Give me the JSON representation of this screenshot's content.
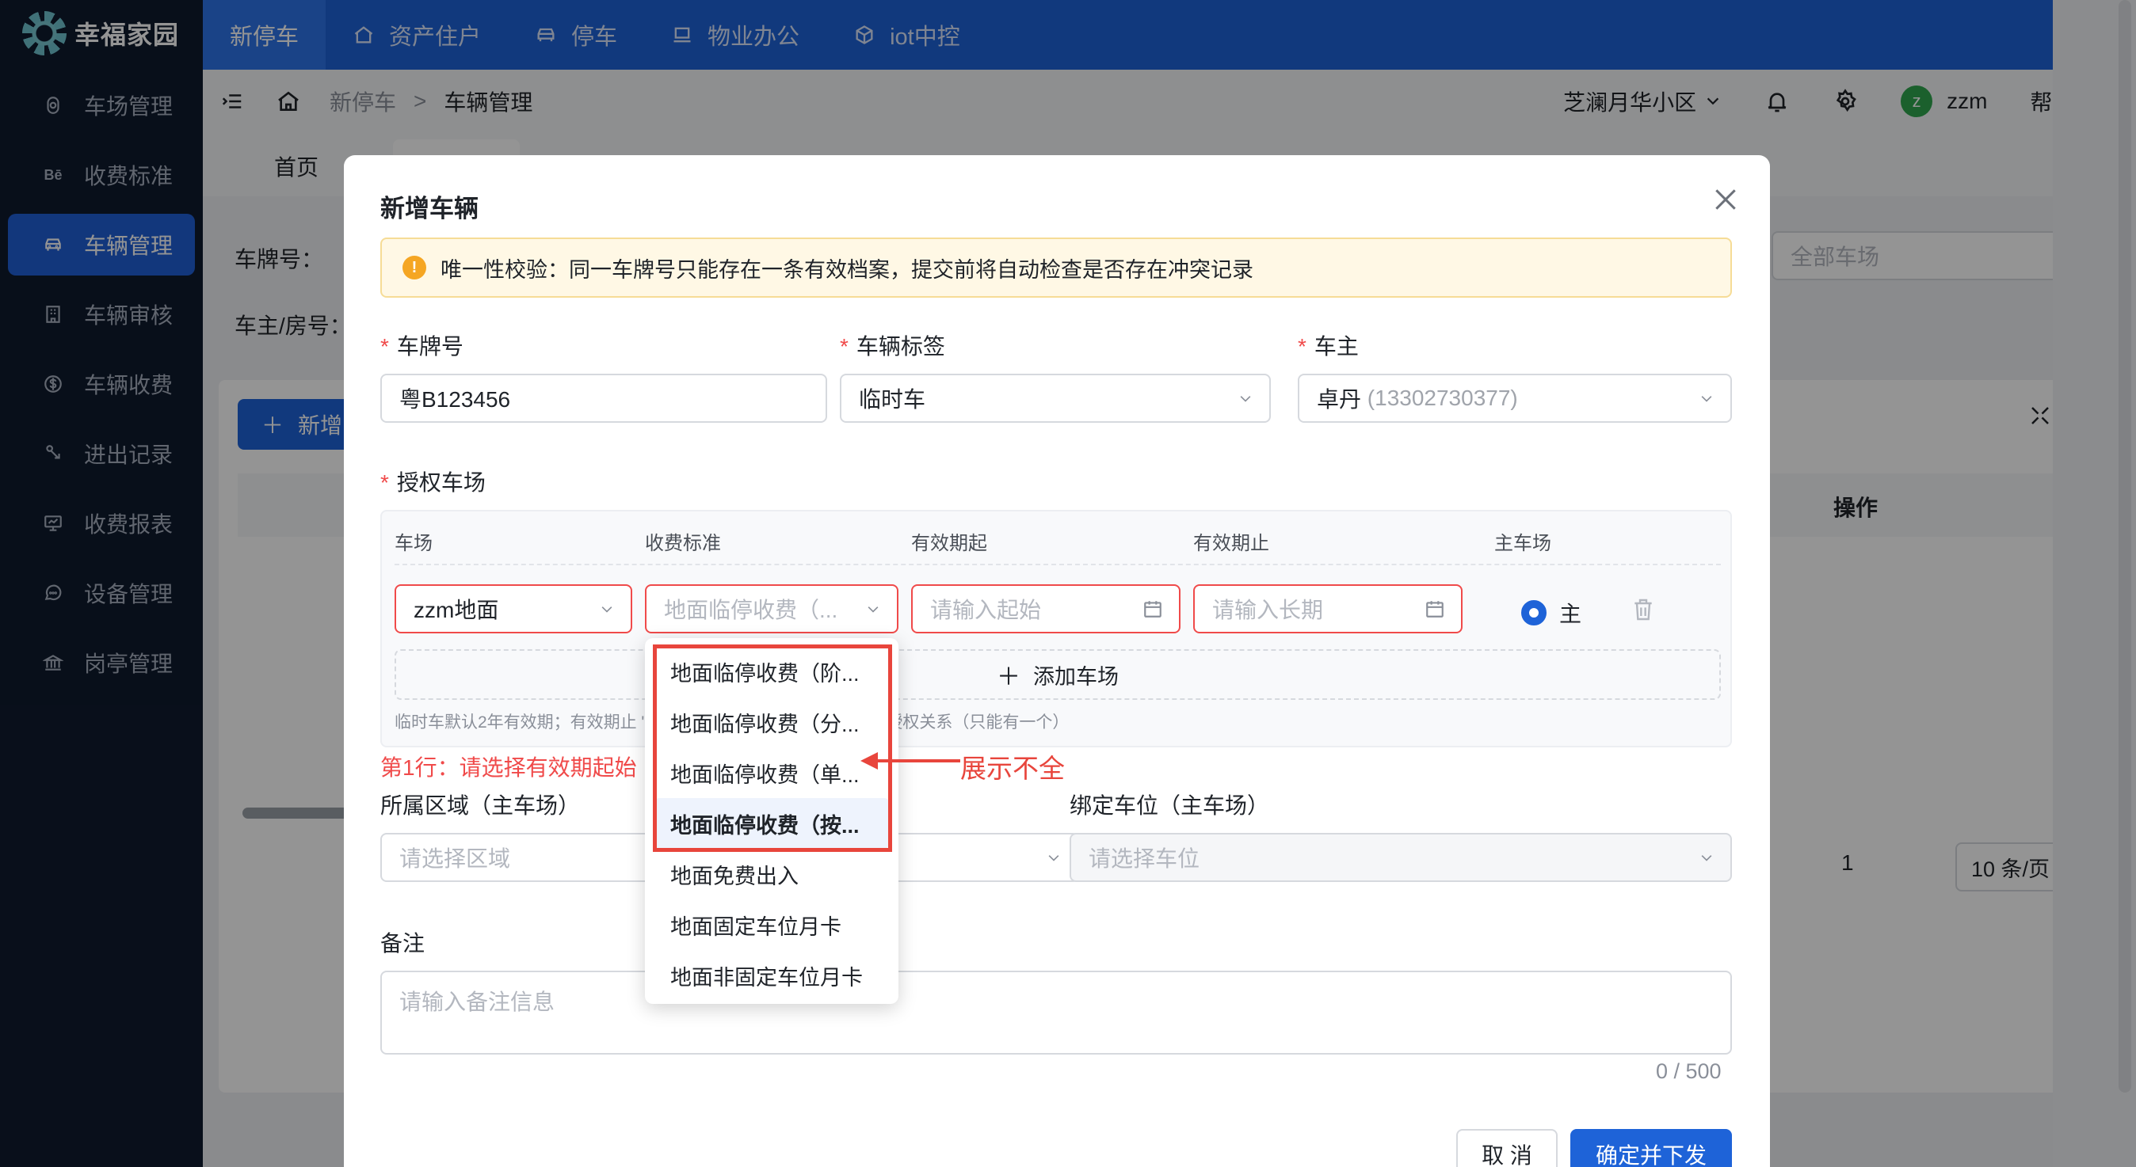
{
  "brand": {
    "name": "幸福家园",
    "accent": "#1e63d8",
    "sidebar_bg": "#0f1a2e"
  },
  "sidebar": {
    "items": [
      {
        "label": "车场管理",
        "icon": "parking-lot-icon"
      },
      {
        "label": "收费标准",
        "icon": "behance-icon"
      },
      {
        "label": "车辆管理",
        "icon": "car-icon",
        "active": true
      },
      {
        "label": "车辆审核",
        "icon": "building-icon"
      },
      {
        "label": "车辆收费",
        "icon": "dollar-icon"
      },
      {
        "label": "进出记录",
        "icon": "gate-icon"
      },
      {
        "label": "收费报表",
        "icon": "monitor-icon"
      },
      {
        "label": "设备管理",
        "icon": "chat-icon"
      },
      {
        "label": "岗亭管理",
        "icon": "bank-icon"
      }
    ]
  },
  "topnav": {
    "items": [
      {
        "label": "新停车",
        "active": true
      },
      {
        "label": "资产住户",
        "icon": "home-icon"
      },
      {
        "label": "停车",
        "icon": "car-icon"
      },
      {
        "label": "物业办公",
        "icon": "laptop-icon"
      },
      {
        "label": "iot中控",
        "icon": "cube-icon"
      }
    ]
  },
  "header": {
    "breadcrumb": [
      "新停车",
      ">",
      "车辆管理"
    ],
    "community": "芝澜月华小区",
    "user": {
      "initial": "z",
      "name": "zzm"
    },
    "help": "帮助文档"
  },
  "tags": {
    "home": "首页"
  },
  "page": {
    "plate_label": "车牌号：",
    "owner_label": "车主/房号：",
    "all_lots": "全部车场",
    "add_btn": "新增",
    "op_header": "操作",
    "page_num": "1",
    "page_size": "10 条/页"
  },
  "dialog": {
    "title": "新增车辆",
    "alert": "唯一性校验：同一车牌号只能存在一条有效档案，提交前将自动检查是否存在冲突记录",
    "plate": {
      "label": "车牌号",
      "value": "粤B123456"
    },
    "tag": {
      "label": "车辆标签",
      "value": "临时车"
    },
    "owner": {
      "label": "车主",
      "value": "卓丹",
      "phone": "(13302730377)"
    },
    "auth_label": "授权车场",
    "table": {
      "headers": [
        "车场",
        "收费标准",
        "有效期起",
        "有效期止",
        "主车场"
      ],
      "row": {
        "lot": "zzm地面",
        "fee_placeholder": "地面临停收费（...",
        "start_placeholder": "请输入起始",
        "end_placeholder": "请输入长期",
        "main": "主"
      },
      "add_row": "添加车场",
      "hint": "临时车默认2年有效期；有效期止                         \"主车场\"用于绑定车位、外系统主授权关系（只能有一个）"
    },
    "error": "第1行：请选择有效期起始",
    "area": {
      "label": "所属区域（主车场）",
      "placeholder": "请选择区域"
    },
    "spot": {
      "label": "绑定车位（主车场）",
      "placeholder": "请选择车位"
    },
    "remark": {
      "label": "备注",
      "placeholder": "请输入备注信息",
      "counter": "0 / 500"
    },
    "cancel": "取 消",
    "confirm": "确定并下发"
  },
  "dropdown": {
    "options": [
      "地面临停收费（阶...",
      "地面临停收费（分...",
      "地面临停收费（单...",
      "地面临停收费（按...",
      "地面免费出入",
      "地面固定车位月卡",
      "地面非固定车位月卡"
    ],
    "selected_index": 3
  },
  "annotation": {
    "text": "展示不全",
    "color": "#e8453c"
  }
}
